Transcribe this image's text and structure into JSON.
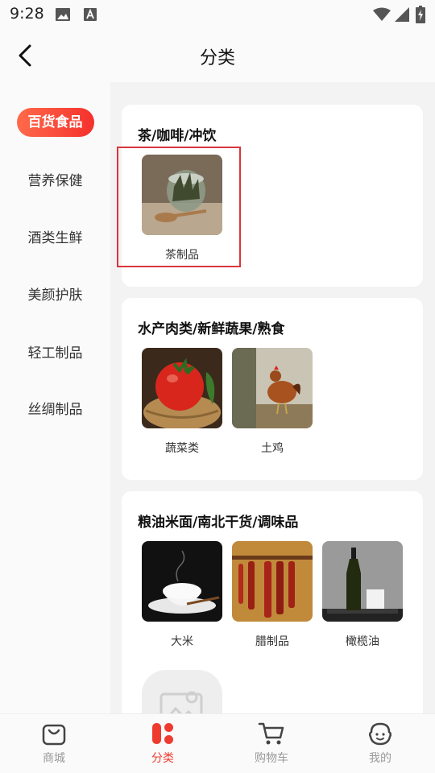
{
  "status_bar": {
    "time": "9:28"
  },
  "header": {
    "title": "分类"
  },
  "sidebar": {
    "items": [
      {
        "label": "百货食品"
      },
      {
        "label": "营养保健"
      },
      {
        "label": "酒类生鲜"
      },
      {
        "label": "美颜护肤"
      },
      {
        "label": "轻工制品"
      },
      {
        "label": "丝绸制品"
      }
    ]
  },
  "sections": [
    {
      "title": "茶/咖啡/冲饮",
      "items": [
        {
          "label": "茶制品"
        }
      ]
    },
    {
      "title": "水产肉类/新鲜蔬果/熟食",
      "items": [
        {
          "label": "蔬菜类"
        },
        {
          "label": "土鸡"
        }
      ]
    },
    {
      "title": "粮油米面/南北干货/调味品",
      "items": [
        {
          "label": "大米"
        },
        {
          "label": "腊制品"
        },
        {
          "label": "橄榄油"
        }
      ]
    }
  ],
  "tabbar": {
    "items": [
      {
        "label": "商城"
      },
      {
        "label": "分类"
      },
      {
        "label": "购物车"
      },
      {
        "label": "我的"
      }
    ]
  },
  "colors": {
    "accent": "#ef3b2f",
    "highlight_box": "#d9363e"
  }
}
